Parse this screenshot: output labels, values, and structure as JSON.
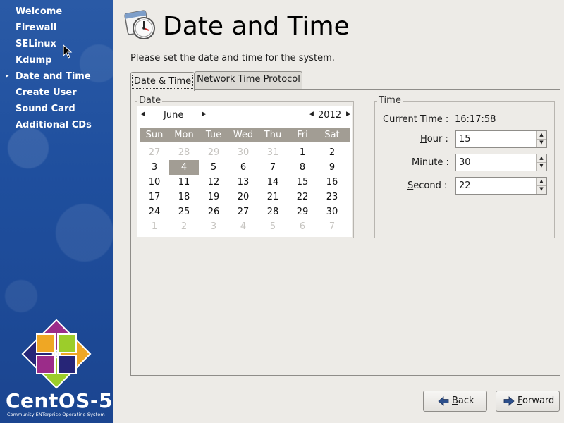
{
  "sidebar": {
    "steps": [
      {
        "label": "Welcome",
        "current": false
      },
      {
        "label": "Firewall",
        "current": false
      },
      {
        "label": "SELinux",
        "current": false
      },
      {
        "label": "Kdump",
        "current": false
      },
      {
        "label": "Date and Time",
        "current": true
      },
      {
        "label": "Create User",
        "current": false
      },
      {
        "label": "Sound Card",
        "current": false
      },
      {
        "label": "Additional CDs",
        "current": false
      }
    ],
    "brand": "CentOS-5",
    "brand_tagline": "Community ENTerprise Operating System"
  },
  "header": {
    "title": "Date and Time",
    "subtitle": "Please set the date and time for the system."
  },
  "tabs": [
    {
      "label": "Date & Time",
      "active": true
    },
    {
      "label": "Network Time Protocol",
      "active": false
    }
  ],
  "date_group": {
    "label": "Date",
    "month": "June",
    "year": "2012",
    "weekdays": [
      "Sun",
      "Mon",
      "Tue",
      "Wed",
      "Thu",
      "Fri",
      "Sat"
    ],
    "selected_day": "4",
    "weeks": [
      [
        {
          "d": "27",
          "m": true
        },
        {
          "d": "28",
          "m": true
        },
        {
          "d": "29",
          "m": true
        },
        {
          "d": "30",
          "m": true
        },
        {
          "d": "31",
          "m": true
        },
        {
          "d": "1",
          "m": false
        },
        {
          "d": "2",
          "m": false
        }
      ],
      [
        {
          "d": "3",
          "m": false
        },
        {
          "d": "4",
          "m": false
        },
        {
          "d": "5",
          "m": false
        },
        {
          "d": "6",
          "m": false
        },
        {
          "d": "7",
          "m": false
        },
        {
          "d": "8",
          "m": false
        },
        {
          "d": "9",
          "m": false
        }
      ],
      [
        {
          "d": "10",
          "m": false
        },
        {
          "d": "11",
          "m": false
        },
        {
          "d": "12",
          "m": false
        },
        {
          "d": "13",
          "m": false
        },
        {
          "d": "14",
          "m": false
        },
        {
          "d": "15",
          "m": false
        },
        {
          "d": "16",
          "m": false
        }
      ],
      [
        {
          "d": "17",
          "m": false
        },
        {
          "d": "18",
          "m": false
        },
        {
          "d": "19",
          "m": false
        },
        {
          "d": "20",
          "m": false
        },
        {
          "d": "21",
          "m": false
        },
        {
          "d": "22",
          "m": false
        },
        {
          "d": "23",
          "m": false
        }
      ],
      [
        {
          "d": "24",
          "m": false
        },
        {
          "d": "25",
          "m": false
        },
        {
          "d": "26",
          "m": false
        },
        {
          "d": "27",
          "m": false
        },
        {
          "d": "28",
          "m": false
        },
        {
          "d": "29",
          "m": false
        },
        {
          "d": "30",
          "m": false
        }
      ],
      [
        {
          "d": "1",
          "m": true
        },
        {
          "d": "2",
          "m": true
        },
        {
          "d": "3",
          "m": true
        },
        {
          "d": "4",
          "m": true
        },
        {
          "d": "5",
          "m": true
        },
        {
          "d": "6",
          "m": true
        },
        {
          "d": "7",
          "m": true
        }
      ]
    ]
  },
  "time_group": {
    "label": "Time",
    "current_time_label": "Current Time :",
    "current_time": "16:17:58",
    "hour": {
      "label_pre": "",
      "mnemonic": "H",
      "label_post": "our :",
      "value": "15"
    },
    "minute": {
      "label_pre": "",
      "mnemonic": "M",
      "label_post": "inute :",
      "value": "30"
    },
    "second": {
      "label_pre": "",
      "mnemonic": "S",
      "label_post": "econd :",
      "value": "22"
    }
  },
  "buttons": {
    "back": {
      "mnemonic": "B",
      "rest": "ack"
    },
    "forward": {
      "mnemonic": "F",
      "rest": "orward"
    }
  },
  "colors": {
    "sidebar_blue": "#1f4f9e",
    "calendar_header": "#a29d94",
    "window_bg": "#edebe7"
  },
  "icons": {
    "title": "clock-calendar-icon",
    "back": "arrow-left-icon",
    "forward": "arrow-right-icon"
  }
}
